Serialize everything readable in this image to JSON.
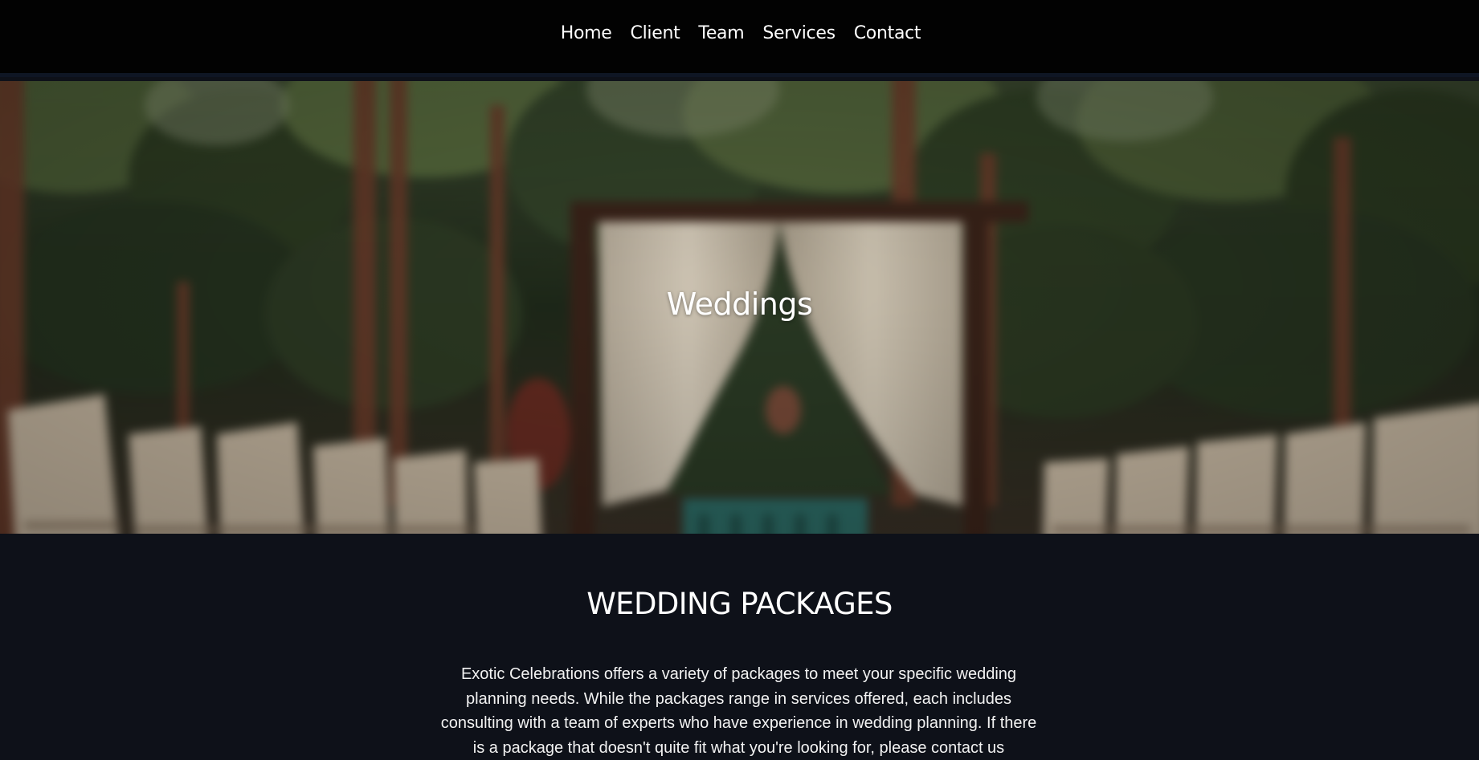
{
  "nav": {
    "items": [
      {
        "label": "Home"
      },
      {
        "label": "Client"
      },
      {
        "label": "Team"
      },
      {
        "label": "Services"
      },
      {
        "label": "Contact"
      }
    ]
  },
  "hero": {
    "title": "Weddings",
    "image_icon": "wedding-arch-photo"
  },
  "packages": {
    "heading": "WEDDING PACKAGES",
    "body": "Exotic Celebrations offers a variety of packages to meet your specific wedding planning needs. While the packages range in services offered, each includes consulting with a team of experts who have experience in wedding planning. If there is a package that doesn't quite fit what you're looking for, please contact us"
  },
  "colors": {
    "nav_bg": "#020202",
    "page_bg": "#0e1119",
    "text": "#ffffff"
  }
}
